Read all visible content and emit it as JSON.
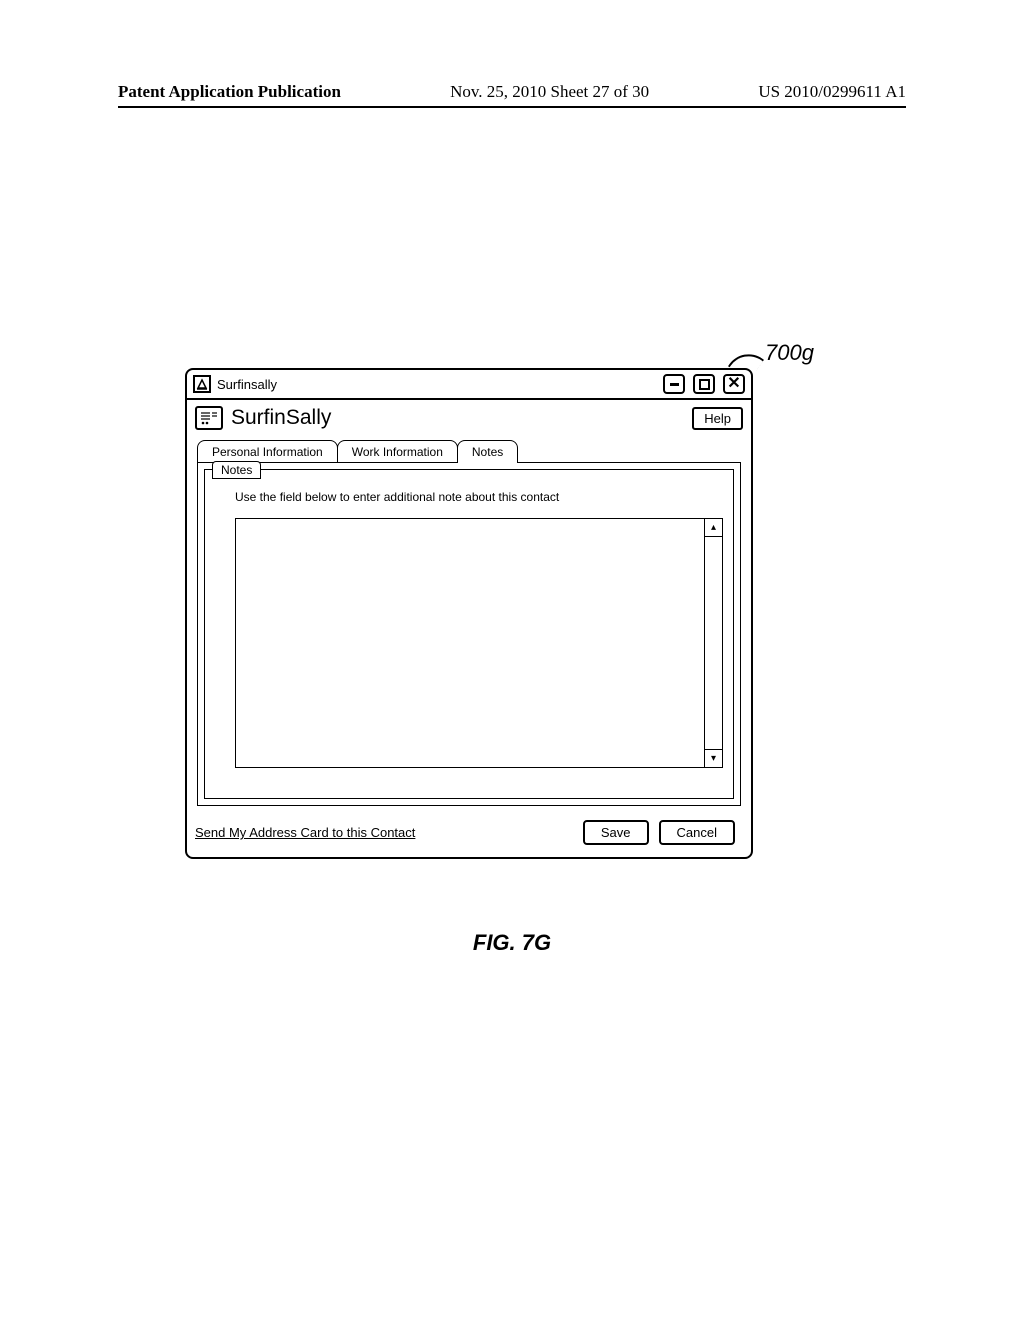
{
  "page_header": {
    "left": "Patent Application Publication",
    "mid": "Nov. 25, 2010  Sheet 27 of 30",
    "right": "US 2010/0299611 A1"
  },
  "ref_label": "700g",
  "window": {
    "title": "Surfinsally",
    "contact_name": "SurfinSally",
    "help_label": "Help",
    "tabs": [
      "Personal Information",
      "Work Information",
      "Notes"
    ],
    "active_tab_index": 2,
    "notes": {
      "panel_label": "Notes",
      "instruction": "Use the field below to enter additional note about this contact",
      "value": ""
    },
    "footer": {
      "send_link": "Send My Address Card to this Contact",
      "save_label": "Save",
      "cancel_label": "Cancel"
    }
  },
  "figure_caption": "FIG. 7G"
}
